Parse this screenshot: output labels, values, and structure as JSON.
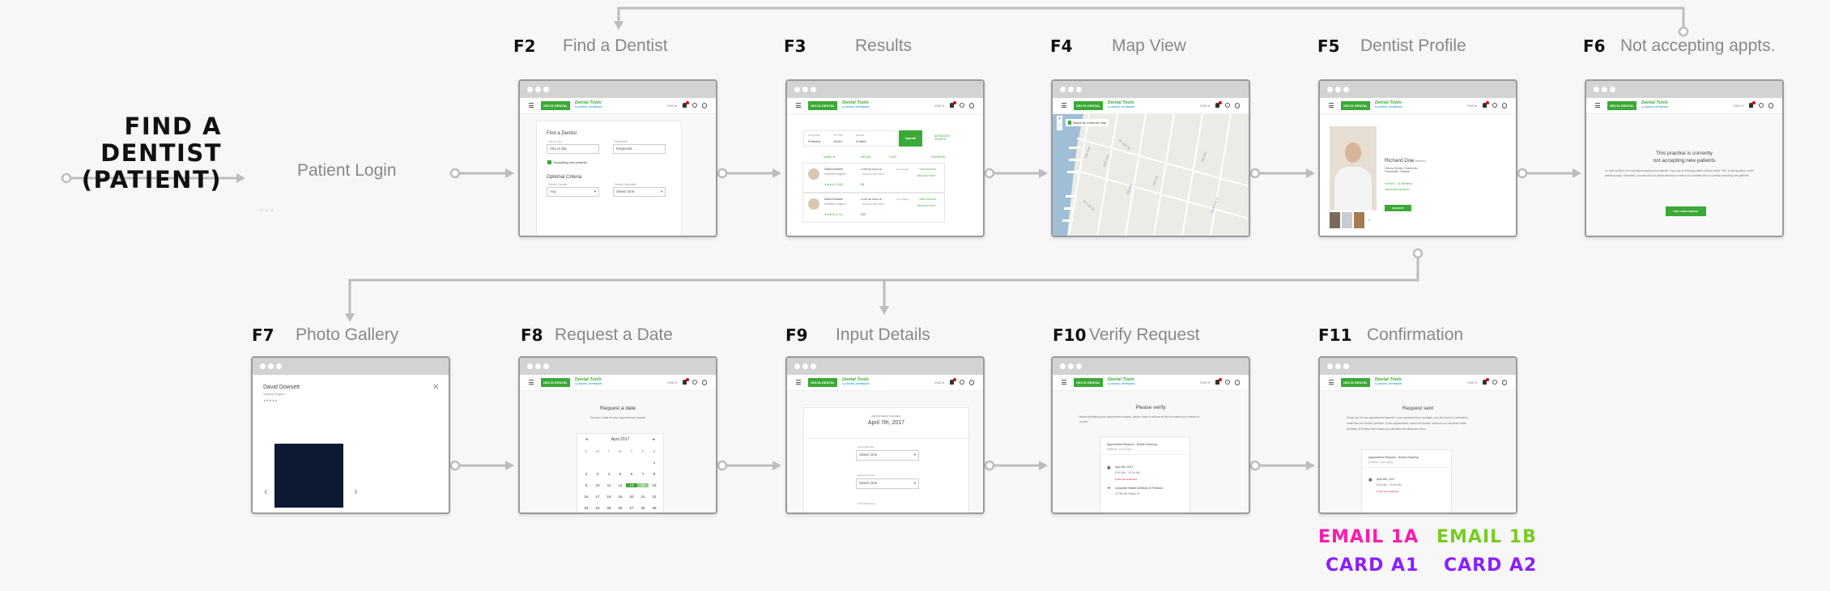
{
  "title": {
    "line1": "FIND A DENTIST",
    "line2": "(PATIENT)"
  },
  "start_step": {
    "label": "Patient Login",
    "dots": "•••"
  },
  "steps": [
    {
      "id": "F2",
      "name": "Find a Dentist"
    },
    {
      "id": "F3",
      "name": "Results"
    },
    {
      "id": "F4",
      "name": "Map View"
    },
    {
      "id": "F5",
      "name": "Dentist Profile"
    },
    {
      "id": "F6",
      "name": "Not accepting appts."
    },
    {
      "id": "F7",
      "name": "Photo Gallery"
    },
    {
      "id": "F8",
      "name": "Request a Date"
    },
    {
      "id": "F9",
      "name": "Input Details"
    },
    {
      "id": "F10",
      "name": "Verify Request"
    },
    {
      "id": "F11",
      "name": "Confirmation"
    }
  ],
  "app_header": {
    "logo": "DELTA DENTAL",
    "product": "Dental Tools",
    "product_sub": "by DENTAL OPTIMIZER",
    "lang": "ENG ▾"
  },
  "f2": {
    "heading": "Find a Dentist",
    "city_label": "City or Zip*",
    "city_value": "City or Zip",
    "kw_label": "Keywords",
    "kw_value": "Keywords",
    "accepting": "Accepting new patients",
    "optional": "Optional Criteria",
    "gender_label": "Dentist Gender",
    "gender_value": "Any",
    "spec_label": "Dentist Specialty",
    "spec_value": "Select One"
  },
  "f3": {
    "kw_label": "KEYWORD",
    "kw_value": "Portland",
    "zip_label": "CITY/ZIP",
    "zip_value": "10012",
    "range_label": "RANGE",
    "range_value": "5 Miles",
    "update": "Update",
    "advanced": "ADVANCED SEARCH",
    "cols": [
      "NAME ▼",
      "RATING",
      "COST",
      "DISTANCE"
    ],
    "rows": [
      {
        "name": "David Dowsett",
        "role": "General Surgeon",
        "addr1": "11765 NE Glisan St",
        "addr2": "Portland, OR 97220",
        "dist": "(3 mi away)",
        "cost": "$$",
        "stars": "★★★★ (1.39)",
        "view": "VIEW PROFILE",
        "req": "REQUEST APPT"
      },
      {
        "name": "David Dowsett",
        "role": "General Surgeon",
        "addr1": "11765 NE Glisan St",
        "addr2": "Portland, OR 97220",
        "dist": "(3 mi away)",
        "cost": "$$$",
        "stars": "★★★★ (1.71)",
        "view": "VIEW PROFILE",
        "req": "REQUEST APPT"
      }
    ]
  },
  "f4": {
    "search_toggle": "Search as I move the map",
    "zoom_in": "+",
    "zoom_out": "−",
    "streets": [
      "11th Ave",
      "10th Ave",
      "W 23rd St",
      "8th Ave",
      "7th Ave",
      "W 14th St",
      "5th Ave",
      "Park Ave S"
    ]
  },
  "f5": {
    "name": "Richard Doe",
    "network": "(In Network)",
    "specialties": "General Dentist, Endodontist, Periodontist, Pediatric",
    "rating": "★★★★ · 31 Reviews",
    "more_reviews": "SEE MORE REVIEWS",
    "request": "REQUEST APPOINTMENT",
    "more_photos": "2+"
  },
  "f6": {
    "heading1": "This practice is currently",
    "heading2": "not accepting new patients",
    "body": "Dr. [last name] is not currently accepting new patients. If you are an existing patient, please select \"Yes\" to last question on the previous page. Otherwise, you can visit our dental directory to search for a dentist who is currently accepting new patients.",
    "button": "FIND A NEW DENTIST"
  },
  "f7": {
    "name": "David Dowsett",
    "role": "General Surgeon",
    "stars": "★★★★★",
    "close": "✕",
    "prev": "‹",
    "next": "›"
  },
  "f8": {
    "heading": "Request a date",
    "sub": "Choose a date for your appointment request",
    "month": "April 2017",
    "prev": "◂",
    "next": "▸",
    "weekdays": [
      "S",
      "M",
      "T",
      "W",
      "T",
      "F",
      "S"
    ],
    "selected": [
      13,
      14
    ]
  },
  "f9": {
    "eyebrow": "APPOINTMENT REQUEST",
    "date": "April 7th, 2017",
    "family_label": "Family Member",
    "family_value": "Select One",
    "reason_label": "Reason for Visit",
    "reason_value": "Select One",
    "time_label": "Time Preference"
  },
  "f10": {
    "heading": "Please verify",
    "body": "Before submitting your appointment request, please check to ensure all the information you entered is correct.",
    "appt_title": "Appointment Request - Dental Cleaning",
    "patient": "(Patient: John Doe)",
    "date": "April 8th, 2017",
    "time": "8:00 AM - 10:00 AM",
    "status": "Not Yet Confirmed",
    "office": "Complete Health Dentistry of Portland",
    "address": "11765 NE Glisan St"
  },
  "f11": {
    "heading": "Request sent",
    "body": "Thank you for your appointment request. If your appointment is accepted, you will receive a verification email from the Dental Optimizer. If your appointment cannot be booked, someone at Complete Health Dentistry of Portland will contact you with alternate dates and times.",
    "appt_title": "Appointment Request - Dental Cleaning",
    "patient": "(Patient: John Doe)",
    "date": "April 8th, 2017",
    "time": "8:00 AM - 10:00 AM",
    "status": "Not Yet Confirmed"
  },
  "tags": {
    "email_1a": "EMAIL 1A",
    "email_1b": "EMAIL 1B",
    "card_a1": "CARD A1",
    "card_a2": "CARD A2"
  },
  "colors": {
    "accent": "#3aa935",
    "connector": "#bdbdbd",
    "email_1a": "#ff1aaa",
    "email_1b": "#77cc22",
    "card": "#8a1fff"
  }
}
